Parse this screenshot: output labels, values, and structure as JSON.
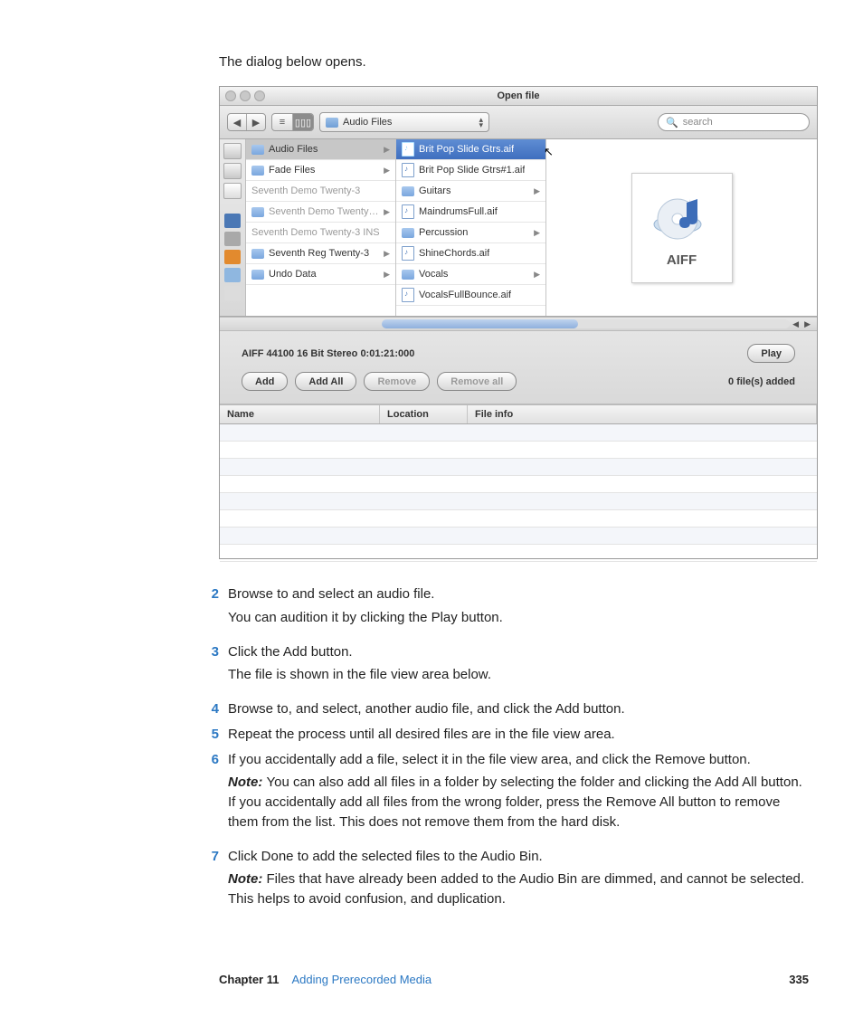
{
  "intro_text": "The dialog below opens.",
  "window": {
    "title": "Open file",
    "path_label": "Audio Files",
    "search_placeholder": "search"
  },
  "col1": [
    {
      "name": "Audio Files",
      "type": "folder",
      "sel": true
    },
    {
      "name": "Fade Files",
      "type": "folder"
    },
    {
      "name": "Seventh Demo Twenty-3",
      "type": "text",
      "dim": true
    },
    {
      "name": "Seventh Demo Twenty-3…",
      "type": "folder",
      "dim": true
    },
    {
      "name": "Seventh Demo Twenty-3 INS",
      "type": "text",
      "dim": true
    },
    {
      "name": "Seventh Reg Twenty-3",
      "type": "folder"
    },
    {
      "name": "Undo Data",
      "type": "folder"
    }
  ],
  "col2": [
    {
      "name": "Brit Pop Slide Gtrs.aif",
      "type": "audio",
      "sel": true
    },
    {
      "name": "Brit Pop Slide Gtrs#1.aif",
      "type": "audio"
    },
    {
      "name": "Guitars",
      "type": "folder"
    },
    {
      "name": "MaindrumsFull.aif",
      "type": "audio"
    },
    {
      "name": "Percussion",
      "type": "folder"
    },
    {
      "name": "ShineChords.aif",
      "type": "audio"
    },
    {
      "name": "Vocals",
      "type": "folder"
    },
    {
      "name": "VocalsFullBounce.aif",
      "type": "audio"
    }
  ],
  "preview_label": "AIFF",
  "info_line": "AIFF   44100   16 Bit   Stereo   0:01:21:000",
  "buttons": {
    "play": "Play",
    "add": "Add",
    "addall": "Add All",
    "remove": "Remove",
    "removeall": "Remove all"
  },
  "status": "0 file(s) added",
  "table_headers": {
    "name": "Name",
    "location": "Location",
    "info": "File info"
  },
  "steps": [
    {
      "n": "2",
      "text": "Browse to and select an audio file.",
      "sub": "You can audition it by clicking the Play button."
    },
    {
      "n": "3",
      "text": "Click the Add button.",
      "sub": "The file is shown in the file view area below."
    },
    {
      "n": "4",
      "text": "Browse to, and select, another audio file, and click the Add button."
    },
    {
      "n": "5",
      "text": "Repeat the process until all desired files are in the file view area."
    },
    {
      "n": "6",
      "text": "If you accidentally add a file, select it in the file view area, and click the Remove button.",
      "note": "You can also add all files in a folder by selecting the folder and clicking the Add All button. If you accidentally add all files from the wrong folder, press the Remove All button to remove them from the list. This does not remove them from the hard disk."
    },
    {
      "n": "7",
      "text": "Click Done to add the selected files to the Audio Bin.",
      "note": "Files that have already been added to the Audio Bin are dimmed, and cannot be selected. This helps to avoid confusion, and duplication."
    }
  ],
  "note_label": "Note:  ",
  "footer": {
    "chapter": "Chapter 11",
    "title": "Adding Prerecorded Media",
    "page": "335"
  }
}
